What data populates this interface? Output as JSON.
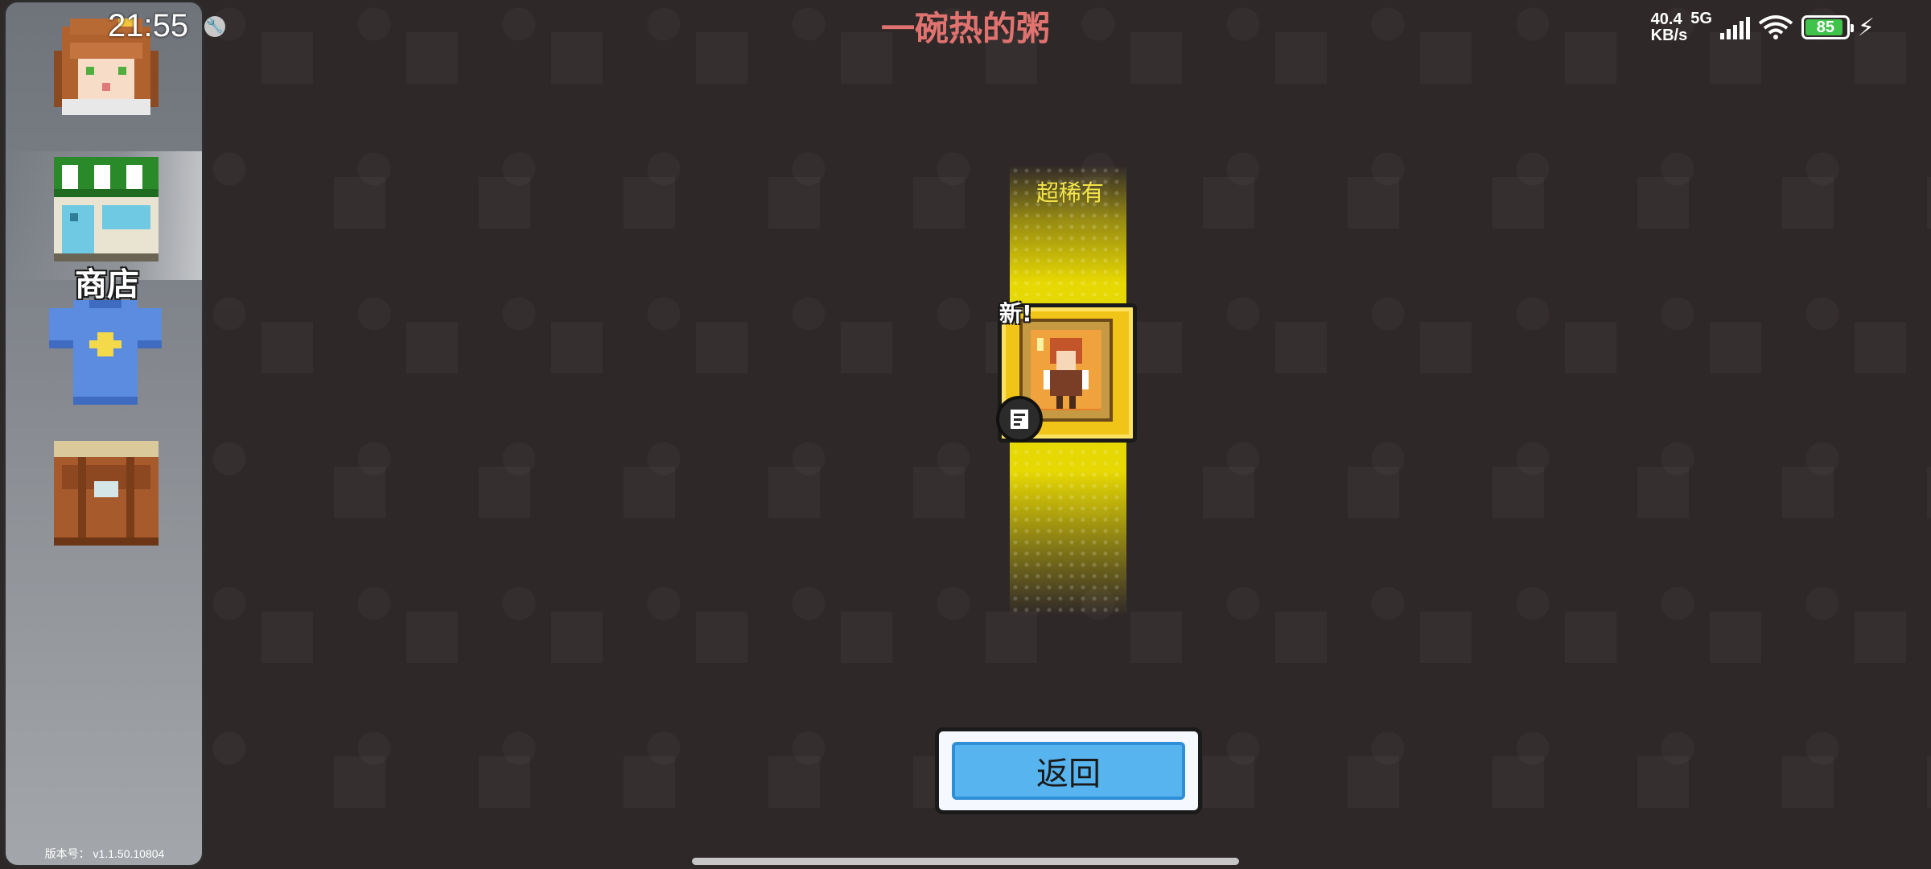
{
  "status_bar": {
    "time": "21:55",
    "net_speed_value": "40.4",
    "net_speed_unit": "KB/s",
    "network_type": "5G",
    "battery_level": "85",
    "icons": [
      "wrench-icon",
      "signal-icon",
      "wifi-icon",
      "battery-icon",
      "charging-bolt-icon"
    ]
  },
  "sidebar": {
    "items": [
      {
        "name": "character",
        "icon": "character-avatar-icon"
      },
      {
        "name": "shop",
        "icon": "shop-icon",
        "label": "商店",
        "active": true
      },
      {
        "name": "outfit",
        "icon": "shirt-icon"
      },
      {
        "name": "bag",
        "icon": "bag-icon"
      }
    ],
    "version": "版本号： v1.1.50.10804"
  },
  "page_title": "一碗热的粥",
  "reward": {
    "rarity": "超稀有",
    "new_badge": "新!",
    "icon": "character-portrait-icon",
    "type_badge_icon": "document-icon",
    "colors": {
      "card": "#f1c418",
      "beam": "#f0e100",
      "rarity_text": "#f3e44a"
    }
  },
  "buttons": {
    "back_label": "返回"
  },
  "colors": {
    "background": "#2f2828",
    "title": "#e0736f",
    "button_fill": "#58b4ef"
  }
}
